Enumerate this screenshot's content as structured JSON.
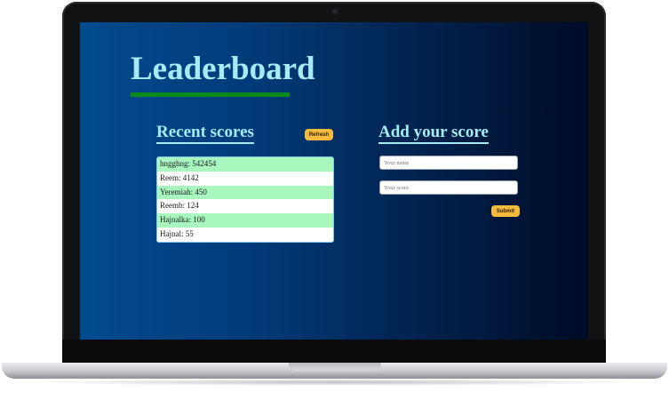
{
  "page": {
    "title": "Leaderboard"
  },
  "recent": {
    "heading": "Recent scores",
    "refresh_label": "Refresh",
    "scores": [
      "hngghng: 542454",
      "Reem: 4142",
      "Yeremiah: 450",
      "Reemb: 124",
      "Hajnalka: 100",
      "Hajnal: 55"
    ]
  },
  "form": {
    "heading": "Add your score",
    "name_placeholder": "Your name",
    "score_placeholder": "Your score",
    "submit_label": "Submit"
  },
  "colors": {
    "accent_heading": "#a6ecf7",
    "title_underline": "#0b8a1c",
    "button": "#f5bb3c",
    "row_highlight": "#a8f7bf"
  }
}
